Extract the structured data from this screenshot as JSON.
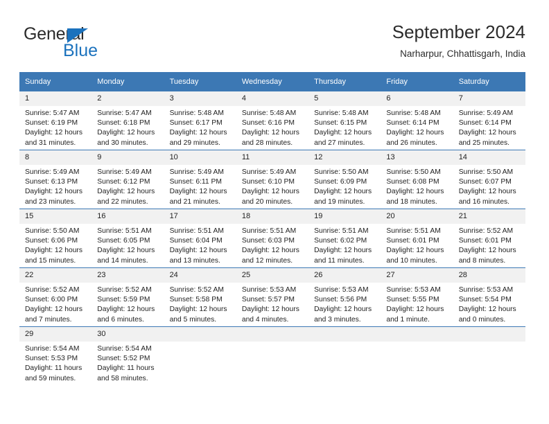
{
  "brand": {
    "name_top": "General",
    "name_bottom": "Blue",
    "triangle_color": "#1b72bd"
  },
  "header": {
    "title": "September 2024",
    "subtitle": "Narharpur, Chhattisgarh, India"
  },
  "theme": {
    "header_blue": "#3c78b4",
    "daynum_gray": "#f1f1f1",
    "text": "#222222"
  },
  "weekday_headers": [
    "Sunday",
    "Monday",
    "Tuesday",
    "Wednesday",
    "Thursday",
    "Friday",
    "Saturday"
  ],
  "weeks": [
    [
      {
        "day": "1",
        "sunrise": "Sunrise: 5:47 AM",
        "sunset": "Sunset: 6:19 PM",
        "daylight": "Daylight: 12 hours and 31 minutes."
      },
      {
        "day": "2",
        "sunrise": "Sunrise: 5:47 AM",
        "sunset": "Sunset: 6:18 PM",
        "daylight": "Daylight: 12 hours and 30 minutes."
      },
      {
        "day": "3",
        "sunrise": "Sunrise: 5:48 AM",
        "sunset": "Sunset: 6:17 PM",
        "daylight": "Daylight: 12 hours and 29 minutes."
      },
      {
        "day": "4",
        "sunrise": "Sunrise: 5:48 AM",
        "sunset": "Sunset: 6:16 PM",
        "daylight": "Daylight: 12 hours and 28 minutes."
      },
      {
        "day": "5",
        "sunrise": "Sunrise: 5:48 AM",
        "sunset": "Sunset: 6:15 PM",
        "daylight": "Daylight: 12 hours and 27 minutes."
      },
      {
        "day": "6",
        "sunrise": "Sunrise: 5:48 AM",
        "sunset": "Sunset: 6:14 PM",
        "daylight": "Daylight: 12 hours and 26 minutes."
      },
      {
        "day": "7",
        "sunrise": "Sunrise: 5:49 AM",
        "sunset": "Sunset: 6:14 PM",
        "daylight": "Daylight: 12 hours and 25 minutes."
      }
    ],
    [
      {
        "day": "8",
        "sunrise": "Sunrise: 5:49 AM",
        "sunset": "Sunset: 6:13 PM",
        "daylight": "Daylight: 12 hours and 23 minutes."
      },
      {
        "day": "9",
        "sunrise": "Sunrise: 5:49 AM",
        "sunset": "Sunset: 6:12 PM",
        "daylight": "Daylight: 12 hours and 22 minutes."
      },
      {
        "day": "10",
        "sunrise": "Sunrise: 5:49 AM",
        "sunset": "Sunset: 6:11 PM",
        "daylight": "Daylight: 12 hours and 21 minutes."
      },
      {
        "day": "11",
        "sunrise": "Sunrise: 5:49 AM",
        "sunset": "Sunset: 6:10 PM",
        "daylight": "Daylight: 12 hours and 20 minutes."
      },
      {
        "day": "12",
        "sunrise": "Sunrise: 5:50 AM",
        "sunset": "Sunset: 6:09 PM",
        "daylight": "Daylight: 12 hours and 19 minutes."
      },
      {
        "day": "13",
        "sunrise": "Sunrise: 5:50 AM",
        "sunset": "Sunset: 6:08 PM",
        "daylight": "Daylight: 12 hours and 18 minutes."
      },
      {
        "day": "14",
        "sunrise": "Sunrise: 5:50 AM",
        "sunset": "Sunset: 6:07 PM",
        "daylight": "Daylight: 12 hours and 16 minutes."
      }
    ],
    [
      {
        "day": "15",
        "sunrise": "Sunrise: 5:50 AM",
        "sunset": "Sunset: 6:06 PM",
        "daylight": "Daylight: 12 hours and 15 minutes."
      },
      {
        "day": "16",
        "sunrise": "Sunrise: 5:51 AM",
        "sunset": "Sunset: 6:05 PM",
        "daylight": "Daylight: 12 hours and 14 minutes."
      },
      {
        "day": "17",
        "sunrise": "Sunrise: 5:51 AM",
        "sunset": "Sunset: 6:04 PM",
        "daylight": "Daylight: 12 hours and 13 minutes."
      },
      {
        "day": "18",
        "sunrise": "Sunrise: 5:51 AM",
        "sunset": "Sunset: 6:03 PM",
        "daylight": "Daylight: 12 hours and 12 minutes."
      },
      {
        "day": "19",
        "sunrise": "Sunrise: 5:51 AM",
        "sunset": "Sunset: 6:02 PM",
        "daylight": "Daylight: 12 hours and 11 minutes."
      },
      {
        "day": "20",
        "sunrise": "Sunrise: 5:51 AM",
        "sunset": "Sunset: 6:01 PM",
        "daylight": "Daylight: 12 hours and 10 minutes."
      },
      {
        "day": "21",
        "sunrise": "Sunrise: 5:52 AM",
        "sunset": "Sunset: 6:01 PM",
        "daylight": "Daylight: 12 hours and 8 minutes."
      }
    ],
    [
      {
        "day": "22",
        "sunrise": "Sunrise: 5:52 AM",
        "sunset": "Sunset: 6:00 PM",
        "daylight": "Daylight: 12 hours and 7 minutes."
      },
      {
        "day": "23",
        "sunrise": "Sunrise: 5:52 AM",
        "sunset": "Sunset: 5:59 PM",
        "daylight": "Daylight: 12 hours and 6 minutes."
      },
      {
        "day": "24",
        "sunrise": "Sunrise: 5:52 AM",
        "sunset": "Sunset: 5:58 PM",
        "daylight": "Daylight: 12 hours and 5 minutes."
      },
      {
        "day": "25",
        "sunrise": "Sunrise: 5:53 AM",
        "sunset": "Sunset: 5:57 PM",
        "daylight": "Daylight: 12 hours and 4 minutes."
      },
      {
        "day": "26",
        "sunrise": "Sunrise: 5:53 AM",
        "sunset": "Sunset: 5:56 PM",
        "daylight": "Daylight: 12 hours and 3 minutes."
      },
      {
        "day": "27",
        "sunrise": "Sunrise: 5:53 AM",
        "sunset": "Sunset: 5:55 PM",
        "daylight": "Daylight: 12 hours and 1 minute."
      },
      {
        "day": "28",
        "sunrise": "Sunrise: 5:53 AM",
        "sunset": "Sunset: 5:54 PM",
        "daylight": "Daylight: 12 hours and 0 minutes."
      }
    ],
    [
      {
        "day": "29",
        "sunrise": "Sunrise: 5:54 AM",
        "sunset": "Sunset: 5:53 PM",
        "daylight": "Daylight: 11 hours and 59 minutes."
      },
      {
        "day": "30",
        "sunrise": "Sunrise: 5:54 AM",
        "sunset": "Sunset: 5:52 PM",
        "daylight": "Daylight: 11 hours and 58 minutes."
      },
      {
        "day": "",
        "sunrise": "",
        "sunset": "",
        "daylight": ""
      },
      {
        "day": "",
        "sunrise": "",
        "sunset": "",
        "daylight": ""
      },
      {
        "day": "",
        "sunrise": "",
        "sunset": "",
        "daylight": ""
      },
      {
        "day": "",
        "sunrise": "",
        "sunset": "",
        "daylight": ""
      },
      {
        "day": "",
        "sunrise": "",
        "sunset": "",
        "daylight": ""
      }
    ]
  ]
}
